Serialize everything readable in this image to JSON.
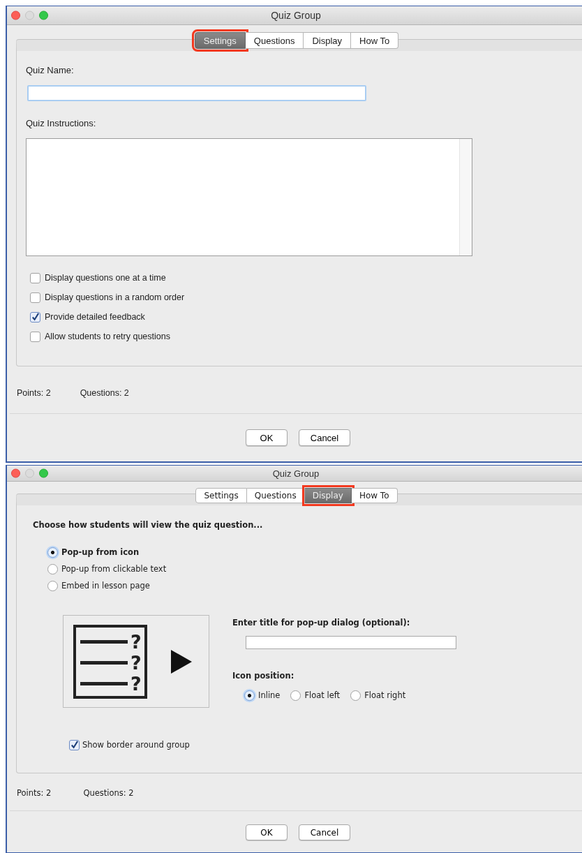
{
  "windows": [
    {
      "kind": "settings",
      "title": "Quiz Group",
      "tabs": [
        {
          "label": "Settings",
          "selected": true
        },
        {
          "label": "Questions",
          "selected": false
        },
        {
          "label": "Display",
          "selected": false
        },
        {
          "label": "How To",
          "selected": false
        }
      ],
      "quiz_name": {
        "label": "Quiz Name:"
      },
      "quiz_instructions": {
        "label": "Quiz Instructions:"
      },
      "options": [
        {
          "label": "Display questions one at a time",
          "checked": false
        },
        {
          "label": "Display questions in a random order",
          "checked": false
        },
        {
          "label": "Provide detailed feedback",
          "checked": true
        },
        {
          "label": "Allow students to retry questions",
          "checked": false
        }
      ],
      "footer": {
        "points": "Points: 2",
        "questions": "Questions: 2"
      },
      "buttons": [
        "OK",
        "Cancel"
      ]
    },
    {
      "kind": "display",
      "title": "Quiz Group",
      "tabs": [
        {
          "label": "Settings",
          "selected": false
        },
        {
          "label": "Questions",
          "selected": false
        },
        {
          "label": "Display",
          "selected": true
        },
        {
          "label": "How To",
          "selected": false
        }
      ],
      "heading": "Choose how students will view the quiz question...",
      "view_modes": [
        {
          "label": "Pop-up from icon",
          "selected": true
        },
        {
          "label": "Pop-up from clickable text",
          "selected": false
        },
        {
          "label": "Embed in lesson page",
          "selected": false
        }
      ],
      "preview_marks": [
        "?",
        "?",
        "?"
      ],
      "popup_title": {
        "label": "Enter title for pop-up dialog (optional):"
      },
      "icon_position": {
        "label": "Icon position:",
        "options": [
          {
            "label": "Inline",
            "selected": true
          },
          {
            "label": "Float left",
            "selected": false
          },
          {
            "label": "Float right",
            "selected": false
          }
        ]
      },
      "show_border": {
        "label": "Show border around group",
        "checked": true
      },
      "footer": {
        "points": "Points: 2",
        "questions": "Questions: 2"
      },
      "buttons": [
        "OK",
        "Cancel"
      ]
    }
  ]
}
